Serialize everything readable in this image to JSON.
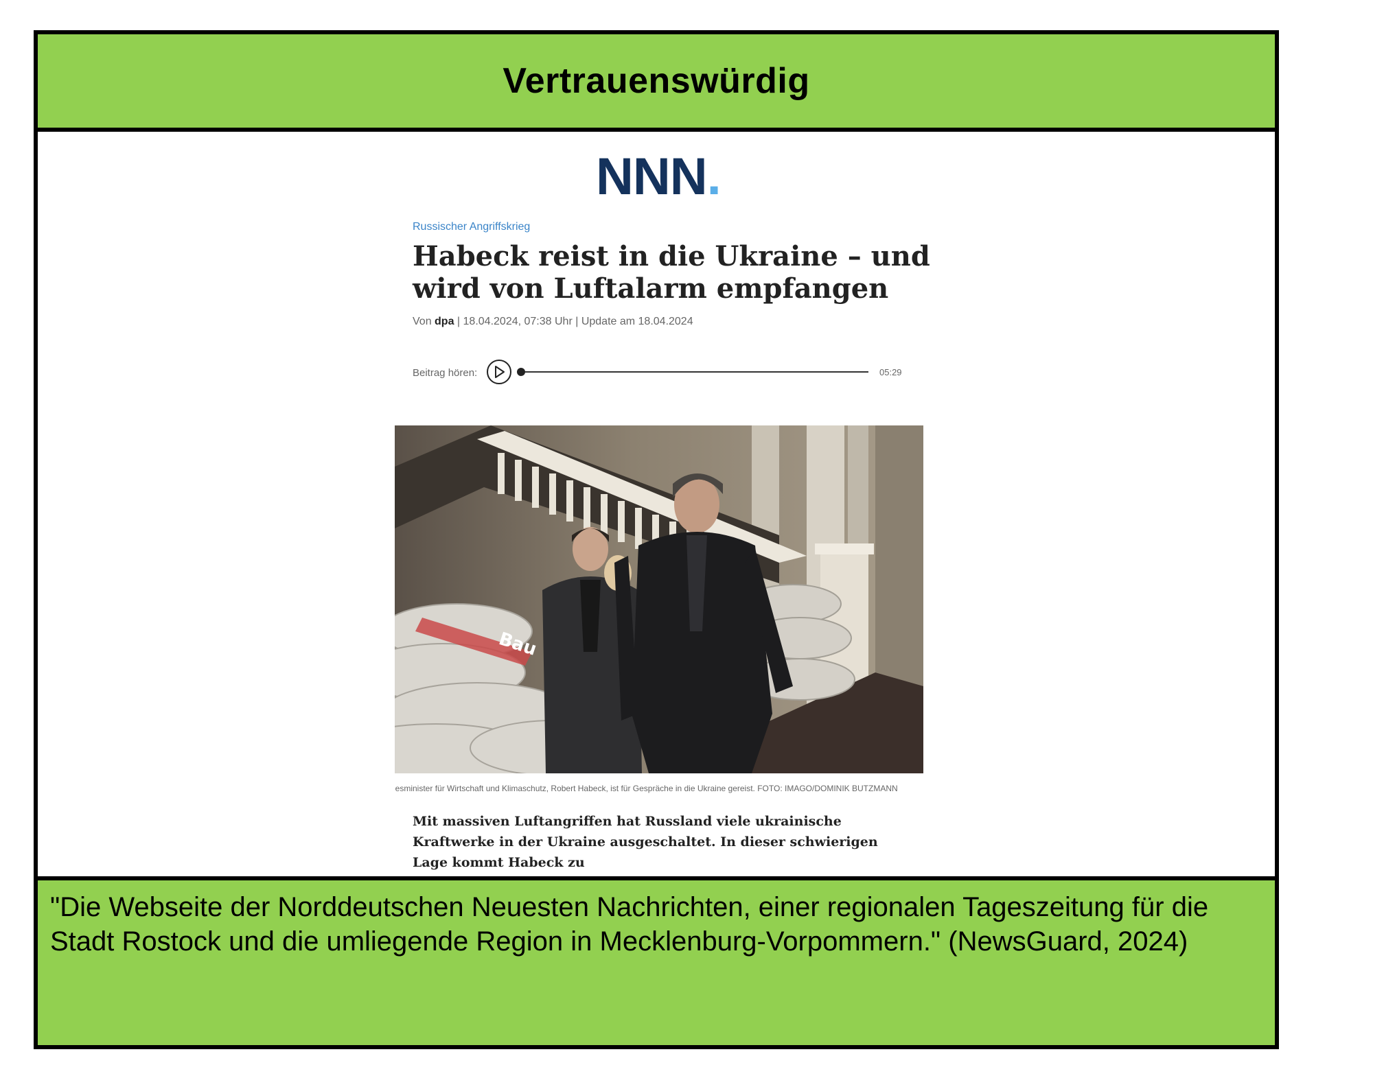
{
  "rating_label": "Vertrauenswürdig",
  "site": {
    "logo_text": "NNN",
    "logo_dot": ".",
    "logo_color": "#14325c",
    "dot_color": "#5aaee8"
  },
  "article": {
    "kicker": "Russischer Angriffskrieg",
    "headline": "Habeck reist in die Ukraine – und wird von Luftalarm empfangen",
    "byline_prefix": "Von ",
    "byline_author": "dpa",
    "byline_rest": " | 18.04.2024, 07:38 Uhr | Update am 18.04.2024",
    "player_label": "Beitrag hören:",
    "player_duration": "05:29",
    "player_progress": 0,
    "photo_caption": "desminister für Wirtschaft und Klimaschutz, Robert Habeck, ist für Gespräche in die Ukraine gereist.  FOTO: IMAGO/DOMINIK BUTZMANN",
    "photo_sack_text": "Bau",
    "lead_text": "Mit massiven Luftangriffen hat Russland viele ukrainische Kraftwerke in der Ukraine ausgeschaltet. In dieser schwierigen Lage kommt Habeck zu"
  },
  "source_quote": "\"Die Webseite der Norddeutschen Neuesten Nachrichten, einer regionalen Tageszeitung für die Stadt Rostock und die umliegende Region in Mecklenburg-Vorpommern.\" (NewsGuard, 2024)",
  "colors": {
    "band_green": "#92d050",
    "border": "#000000",
    "kicker_blue": "#3a84c8"
  }
}
